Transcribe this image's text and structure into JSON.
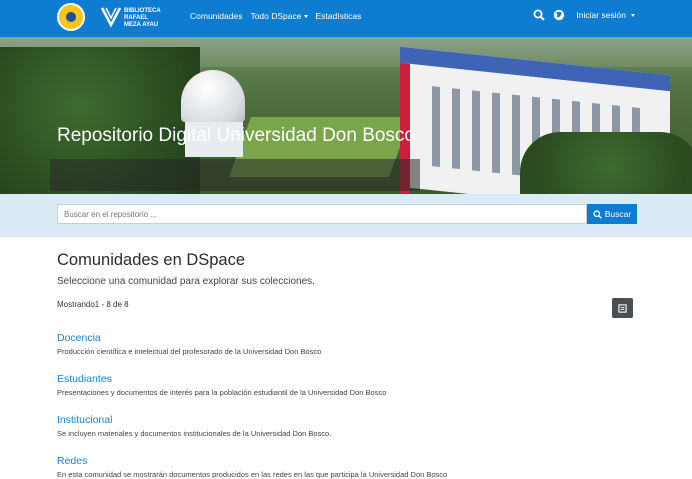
{
  "brand": {
    "logo_lines": [
      "BIBLIOTECA",
      "RAFAEL",
      "MEZA AYAU"
    ]
  },
  "nav": {
    "links": [
      "Comunidades",
      "Todo DSpace",
      "Estadísticas"
    ],
    "login_label": "Iniciar sesión"
  },
  "hero": {
    "title": "Repositorio Digital Universidad Don Bosco"
  },
  "search": {
    "placeholder": "Buscar en el repositorio ...",
    "button_label": "Buscar"
  },
  "main": {
    "title": "Comunidades en DSpace",
    "subtitle": "Seleccione una comunidad para explorar sus colecciones.",
    "showing": "Mostrando1 - 8 de 8",
    "communities": [
      {
        "name": "Docencia",
        "description": "Producción científica e intelectual del profesorado de la Universidad Don Bosco"
      },
      {
        "name": "Estudiantes",
        "description": "Presentaciones y documentos de interés para la población estudiantil de la Universidad Don Bosco"
      },
      {
        "name": "Institucional",
        "description": "Se incluyen materiales y documentos institucionales de la Universidad Don Bosco."
      },
      {
        "name": "Redes",
        "description": "En esta comunidad se mostrarán documentos producidos en las redes en las que participa la Universidad Don Bosco"
      }
    ]
  },
  "colors": {
    "navbar": "#0e7cd0",
    "link": "#1f82cf",
    "search_band": "#dbeaf7"
  },
  "icons": {
    "search": "search-icon",
    "language": "globe-icon",
    "export": "export-icon"
  }
}
